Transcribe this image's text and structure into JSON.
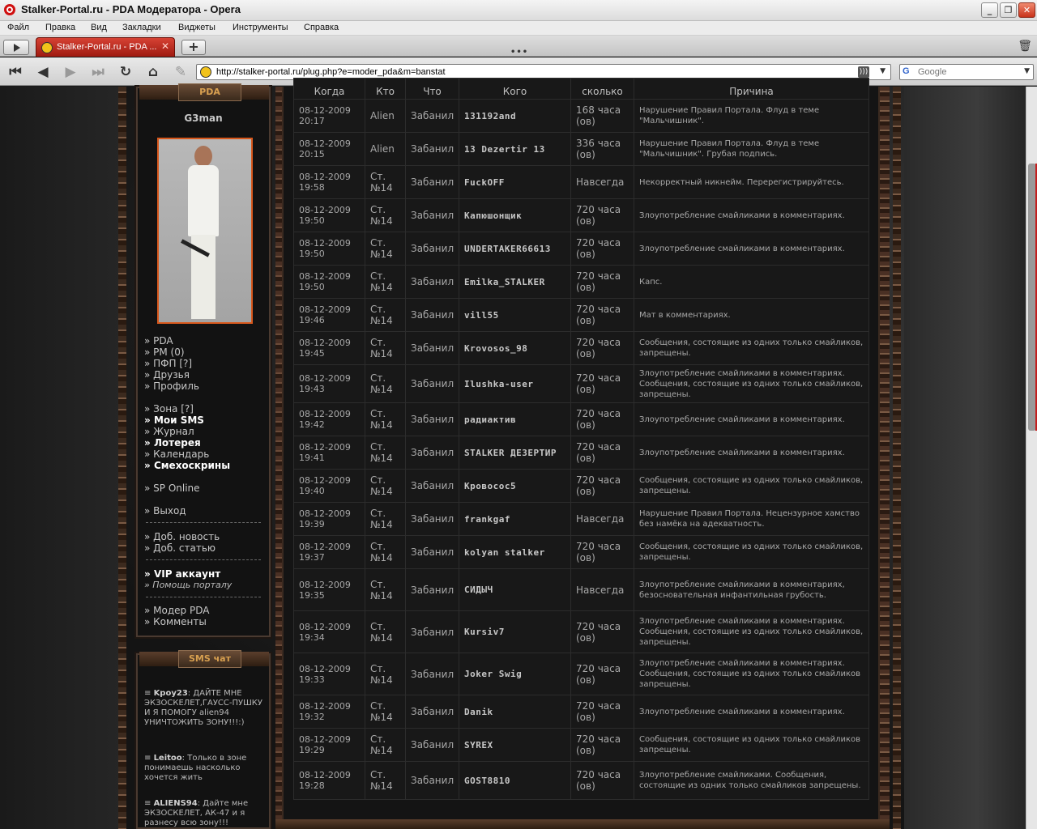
{
  "window": {
    "title": "Stalker-Portal.ru - PDA Модератора - Opera"
  },
  "menu": [
    "Файл",
    "Правка",
    "Вид",
    "Закладки",
    "Виджеты",
    "Инструменты",
    "Справка"
  ],
  "tab": {
    "label": "Stalker-Portal.ru - PDA ..."
  },
  "address": {
    "url": "http://stalker-portal.ru/plug.php?e=moder_pda&m=banstat"
  },
  "search": {
    "placeholder": "Google"
  },
  "sidebar": {
    "pda_header": "PDA",
    "username": "G3man",
    "menu1": [
      "PDA",
      "PM (0)",
      "ПФП [?]",
      "Друзья",
      "Профиль"
    ],
    "menu2": [
      "Зона [?]",
      "Мои SMS",
      "Журнал",
      "Лотерея",
      "Календарь",
      "Смехоскрины"
    ],
    "menu3": [
      "SP Online"
    ],
    "menu4": [
      "Выход"
    ],
    "menu5": [
      "Доб. новость",
      "Доб. статью"
    ],
    "menu6": [
      "VIP аккаунт",
      "Помощь порталу"
    ],
    "menu7": [
      "Модер PDA",
      "Комменты"
    ],
    "sms_header": "SMS чат",
    "sms": [
      {
        "user": "Kpoy23",
        "text": ": ДАЙТЕ МНЕ ЭКЗОСКЕЛЕТ,ГАУСС-ПУШКУ И Я ПОМОГУ alien94 УНИЧТОЖИТЬ ЗОНУ!!!:)"
      },
      {
        "user": "Leitoo",
        "text": ": Только в зоне понимаешь насколько хочется жить"
      },
      {
        "user": "ALIENS94",
        "text": ": Дайте мне ЭКЗОСКЕЛЕТ, АК-47 и я разнесу всю зону!!!"
      }
    ]
  },
  "table": {
    "headers": [
      "Когда",
      "Кто",
      "Что",
      "Кого",
      "сколько",
      "Причина"
    ],
    "rows": [
      {
        "date": "08-12-2009 20:17",
        "who": "Alien",
        "action": "Забанил",
        "nick": "131192and",
        "dur": "168 часа (ов)",
        "reason": "Нарушение Правил Портала. Флуд в теме \"Мальчишник\"."
      },
      {
        "date": "08-12-2009 20:15",
        "who": "Alien",
        "action": "Забанил",
        "nick": "13 Dezertir 13",
        "dur": "336 часа (ов)",
        "reason": "Нарушение Правил Портала. Флуд в теме \"Мальчишник\". Грубая подпись."
      },
      {
        "date": "08-12-2009 19:58",
        "who": "Ст. №14",
        "action": "Забанил",
        "nick": "FuckOFF",
        "dur": "Навсегда",
        "reason": "Некорректный никнейм. Перерегистрируйтесь."
      },
      {
        "date": "08-12-2009 19:50",
        "who": "Ст. №14",
        "action": "Забанил",
        "nick": "Капюшонщик",
        "dur": "720 часа (ов)",
        "reason": "Злоупотребление смайликами в комментариях."
      },
      {
        "date": "08-12-2009 19:50",
        "who": "Ст. №14",
        "action": "Забанил",
        "nick": "UNDERTAKER66613",
        "dur": "720 часа (ов)",
        "reason": "Злоупотребление смайликами в комментариях."
      },
      {
        "date": "08-12-2009 19:50",
        "who": "Ст. №14",
        "action": "Забанил",
        "nick": "Emilka_STALKER",
        "dur": "720 часа (ов)",
        "reason": "Капс."
      },
      {
        "date": "08-12-2009 19:46",
        "who": "Ст. №14",
        "action": "Забанил",
        "nick": "vill55",
        "dur": "720 часа (ов)",
        "reason": "Мат в комментариях."
      },
      {
        "date": "08-12-2009 19:45",
        "who": "Ст. №14",
        "action": "Забанил",
        "nick": "Krovosos_98",
        "dur": "720 часа (ов)",
        "reason": "Сообщения, состоящие из одних только смайликов, запрещены."
      },
      {
        "date": "08-12-2009 19:43",
        "who": "Ст. №14",
        "action": "Забанил",
        "nick": "Ilushka-user",
        "dur": "720 часа (ов)",
        "reason": "Злоупотребление смайликами в комментариях. Сообщения, состоящие из одних только смайликов, запрещены."
      },
      {
        "date": "08-12-2009 19:42",
        "who": "Ст. №14",
        "action": "Забанил",
        "nick": "радиактив",
        "dur": "720 часа (ов)",
        "reason": "Злоупотребление смайликами в комментариях."
      },
      {
        "date": "08-12-2009 19:41",
        "who": "Ст. №14",
        "action": "Забанил",
        "nick": "STALKER ДЕЗЕРТИР",
        "dur": "720 часа (ов)",
        "reason": "Злоупотребление смайликами в комментариях."
      },
      {
        "date": "08-12-2009 19:40",
        "who": "Ст. №14",
        "action": "Забанил",
        "nick": "Кровосос5",
        "dur": "720 часа (ов)",
        "reason": "Сообщения, состоящие из одних только смайликов, запрещены."
      },
      {
        "date": "08-12-2009 19:39",
        "who": "Ст. №14",
        "action": "Забанил",
        "nick": "frankgaf",
        "dur": "Навсегда",
        "reason": "Нарушение Правил Портала. Нецензурное хамство без намёка на адекватность."
      },
      {
        "date": "08-12-2009 19:37",
        "who": "Ст. №14",
        "action": "Забанил",
        "nick": "kolyan stalker",
        "dur": "720 часа (ов)",
        "reason": "Сообщения, состоящие из одних только смайликов, запрещены."
      },
      {
        "date": "08-12-2009 19:35",
        "who": "Ст. №14",
        "action": "Забанил",
        "nick": "СИДЫЧ",
        "dur": "Навсегда",
        "reason": "Злоупотребление смайликами в комментариях, безосновательная инфантильная грубость."
      },
      {
        "date": "08-12-2009 19:34",
        "who": "Ст. №14",
        "action": "Забанил",
        "nick": "Kursiv7",
        "dur": "720 часа (ов)",
        "reason": "Злоупотребление смайликами в комментариях. Сообщения, состоящие из одних только смайликов, запрещены."
      },
      {
        "date": "08-12-2009 19:33",
        "who": "Ст. №14",
        "action": "Забанил",
        "nick": "Joker Swig",
        "dur": "720 часа (ов)",
        "reason": "Злоупотребление смайликами в комментариях. Сообщения, состоящие из одних только смайликов запрещены."
      },
      {
        "date": "08-12-2009 19:32",
        "who": "Ст. №14",
        "action": "Забанил",
        "nick": "Danik",
        "dur": "720 часа (ов)",
        "reason": "Злоупотребление смайликами в комментариях."
      },
      {
        "date": "08-12-2009 19:29",
        "who": "Ст. №14",
        "action": "Забанил",
        "nick": "SYREX",
        "dur": "720 часа (ов)",
        "reason": "Сообщения, состоящие из одних только смайликов запрещены."
      },
      {
        "date": "08-12-2009 19:28",
        "who": "Ст. №14",
        "action": "Забанил",
        "nick": "GOST8810",
        "dur": "720 часа (ов)",
        "reason": "Злоупотребление смайликами. Сообщения, состоящие из одних только смайликов запрещены."
      }
    ]
  }
}
